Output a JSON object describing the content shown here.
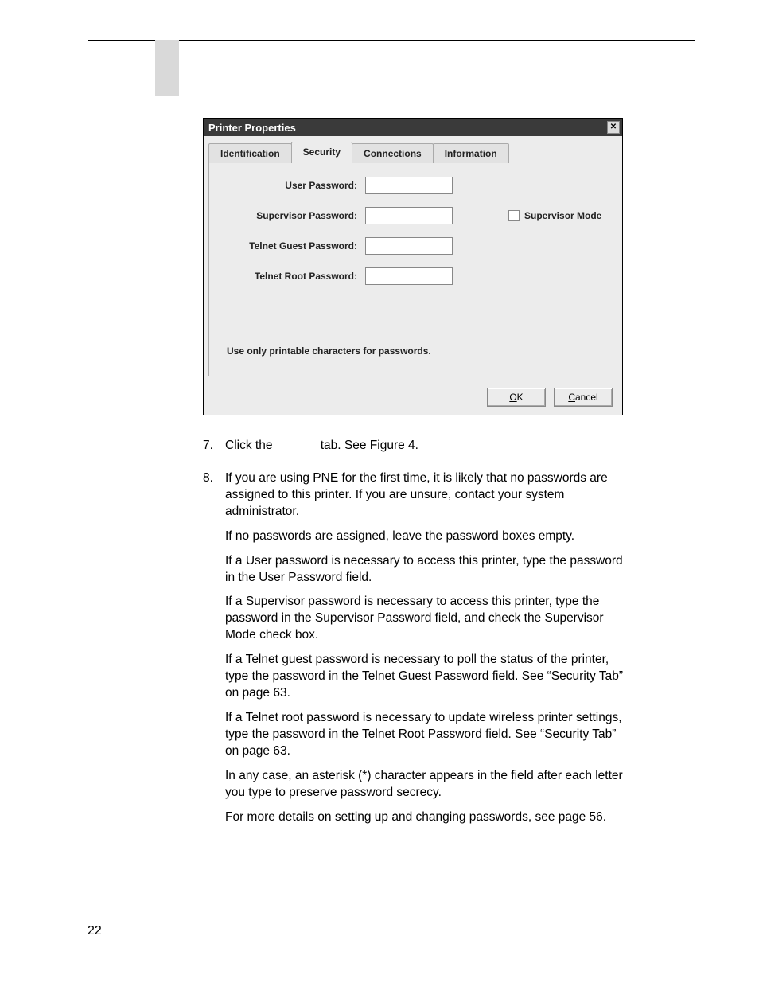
{
  "dialog": {
    "title": "Printer Properties",
    "tabs": [
      "Identification",
      "Security",
      "Connections",
      "Information"
    ],
    "active_tab_index": 1,
    "fields": {
      "user_password_label": "User Password:",
      "supervisor_password_label": "Supervisor Password:",
      "telnet_guest_password_label": "Telnet Guest Password:",
      "telnet_root_password_label": "Telnet Root Password:",
      "supervisor_mode_label": "Supervisor Mode",
      "user_password_value": "",
      "supervisor_password_value": "",
      "telnet_guest_password_value": "",
      "telnet_root_password_value": ""
    },
    "hint": "Use only printable characters for passwords.",
    "buttons": {
      "ok": "OK",
      "cancel": "Cancel"
    }
  },
  "steps": {
    "s7_num": "7.",
    "s7_text_a": "Click the ",
    "s7_text_b": " tab. See Figure 4.",
    "s8_num": "8.",
    "s8_p1": "If you are using PNE for the first time, it is likely that no passwords are assigned to this printer. If you are unsure, contact your system administrator.",
    "s8_p2": "If no passwords are assigned, leave the password boxes empty.",
    "s8_p3": "If a User password is necessary to access this printer, type the password in the User Password field.",
    "s8_p4": "If a Supervisor password is necessary to access this printer, type the password in the Supervisor Password field, and check the Supervisor Mode check box.",
    "s8_p5": "If a Telnet guest password is necessary to poll the status of the printer, type the password in the Telnet Guest Password field. See “Security Tab” on page 63.",
    "s8_p6": "If a Telnet root password is necessary to update wireless printer settings, type the password in the Telnet Root Password field. See “Security Tab” on page 63.",
    "s8_p7": "In any case, an asterisk (*) character appears in the field after each letter you type to preserve password secrecy.",
    "s8_p8": "For more details on setting up and changing passwords, see page 56."
  },
  "page_number": "22"
}
